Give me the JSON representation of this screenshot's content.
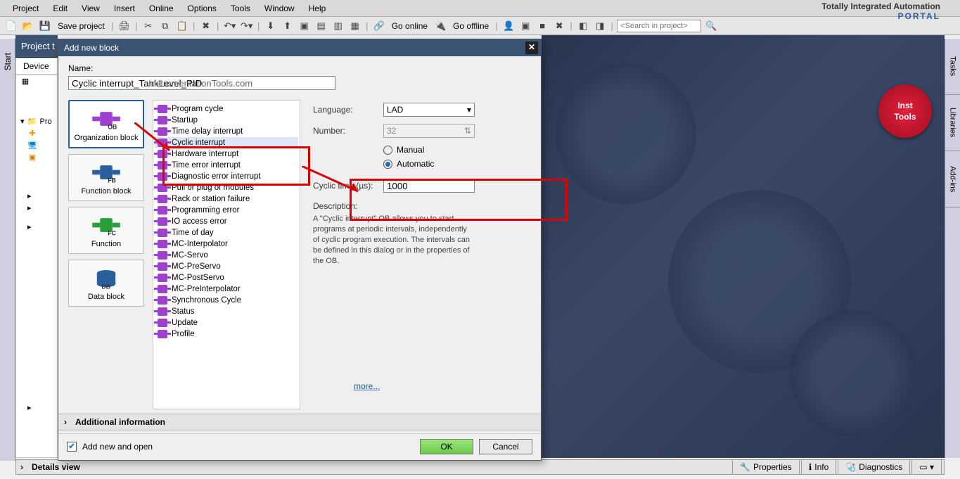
{
  "menu": {
    "items": [
      "Project",
      "Edit",
      "View",
      "Insert",
      "Online",
      "Options",
      "Tools",
      "Window",
      "Help"
    ]
  },
  "brand": {
    "line1": "Totally Integrated Automation",
    "line2": "PORTAL"
  },
  "toolbar": {
    "save": "Save project",
    "go_online": "Go online",
    "go_offline": "Go offline",
    "search_placeholder": "<Search in project>"
  },
  "left": {
    "start": "Start",
    "project": "Project t",
    "devices": "Device",
    "tree0": "Pro"
  },
  "details": {
    "label": "Details view"
  },
  "right_tabs": {
    "t1": "Tasks",
    "t2": "Libraries",
    "t3": "Add-ins"
  },
  "badge": {
    "l1": "Inst",
    "l2": "Tools"
  },
  "status": {
    "props": "Properties",
    "info": "Info",
    "diag": "Diagnostics"
  },
  "dialog": {
    "title": "Add new block",
    "watermark": "InstrumentationTools.com",
    "name_label": "Name:",
    "name_value": "Cyclic interrupt_TankLevel_PID",
    "blocks": {
      "ob": "Organization block",
      "fb": "Function block",
      "fc": "Function",
      "db": "Data block"
    },
    "list": [
      "Program cycle",
      "Startup",
      "Time delay interrupt",
      "Cyclic interrupt",
      "Hardware interrupt",
      "Time error interrupt",
      "Diagnostic error interrupt",
      "Pull or plug of modules",
      "Rack or station failure",
      "Programming error",
      "IO access error",
      "Time of day",
      "MC-Interpolator",
      "MC-Servo",
      "MC-PreServo",
      "MC-PostServo",
      "MC-PreInterpolator",
      "Synchronous Cycle",
      "Status",
      "Update",
      "Profile"
    ],
    "selected_index": 3,
    "detail": {
      "language_label": "Language:",
      "language_value": "LAD",
      "number_label": "Number:",
      "number_value": "32",
      "manual": "Manual",
      "automatic": "Automatic",
      "cycle_label": "Cyclic time (µs):",
      "cycle_value": "1000",
      "desc_head": "Description:",
      "desc_text": "A \"Cyclic interrupt\" OB allows you to start programs at periodic intervals, independently of cyclic program execution. The intervals can be defined in this dialog or in the properties of the OB.",
      "more": "more..."
    },
    "addinfo": "Additional information",
    "footer": {
      "chk": "Add new and open",
      "ok": "OK",
      "cancel": "Cancel"
    }
  }
}
